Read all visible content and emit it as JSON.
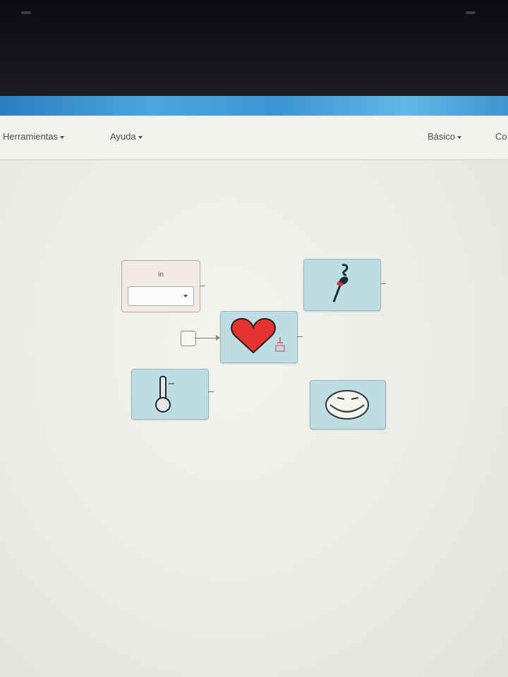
{
  "menubar": {
    "left_items": [
      {
        "label": "Herramientas"
      },
      {
        "label": "Ayuda"
      }
    ],
    "right_items": [
      {
        "label": "Básico"
      },
      {
        "label": "Co"
      }
    ]
  },
  "canvas": {
    "input_block": {
      "label": "in",
      "selected_value": ""
    }
  },
  "colors": {
    "block_fill": "#bcdde4",
    "title_bar": "#3d95d4",
    "heart": "#e3342f"
  },
  "icons": [
    "microphone-icon",
    "heart-icon",
    "toggle-switch-icon",
    "trollface-icon",
    "checkbox-icon",
    "dropdown-caret-icon"
  ]
}
